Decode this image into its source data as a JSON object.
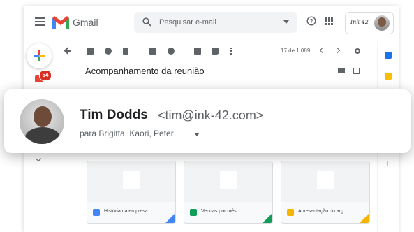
{
  "header": {
    "app_name": "Gmail",
    "search_placeholder": "Pesquisar e-mail",
    "brand_chip": "Ink 42"
  },
  "left_rail": {
    "inbox_badge": "54"
  },
  "toolbar": {
    "page_count": "17 de 1.089"
  },
  "email": {
    "subject": "Acompanhamento da reunião",
    "sender_name": "Tim Dodds",
    "sender_email": "<tim@ink-42.com>",
    "recipients": "para Brigitta, Kaori, Peter"
  },
  "attachments": [
    {
      "name": "História da empresa",
      "type": "doc",
      "color": "#4285f4"
    },
    {
      "name": "Vendas por mês",
      "type": "sheet",
      "color": "#0f9d58"
    },
    {
      "name": "Apresentação do arg...",
      "type": "slide",
      "color": "#f4b400"
    }
  ],
  "colors": {
    "accent_blue": "#1a73e8",
    "gmail_red": "#ea4335",
    "badge_red": "#d93025"
  }
}
